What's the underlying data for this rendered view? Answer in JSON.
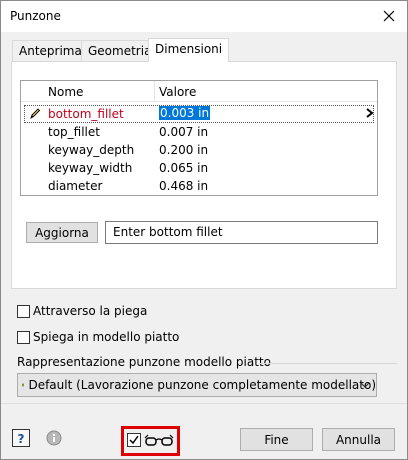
{
  "window": {
    "title": "Punzone"
  },
  "tabs": [
    {
      "label": "Anteprima"
    },
    {
      "label": "Geometria"
    },
    {
      "label": "Dimensioni"
    }
  ],
  "grid": {
    "headers": {
      "name": "Nome",
      "value": "Valore"
    },
    "rows": [
      {
        "name": "bottom_fillet",
        "value": "0.003 in"
      },
      {
        "name": "top_fillet",
        "value": "0.007 in"
      },
      {
        "name": "keyway_depth",
        "value": "0.200 in"
      },
      {
        "name": "keyway_width",
        "value": "0.065 in"
      },
      {
        "name": "diameter",
        "value": "0.468 in"
      }
    ]
  },
  "update": {
    "button_label": "Aggiorna",
    "hint": "Enter bottom fillet"
  },
  "options": {
    "fold_label": "Attraverso la piega",
    "flat_label": "Spiega in modello piatto"
  },
  "flat_pattern": {
    "group_label": "Rappresentazione punzone modello piatto",
    "selected": "Default (Lavorazione punzone completamente modellato)"
  },
  "footer": {
    "ok_label": "Fine",
    "cancel_label": "Annulla"
  },
  "colors": {
    "selection": "#0078d7",
    "selected_name": "#c0001a",
    "highlight": "#e00000"
  }
}
